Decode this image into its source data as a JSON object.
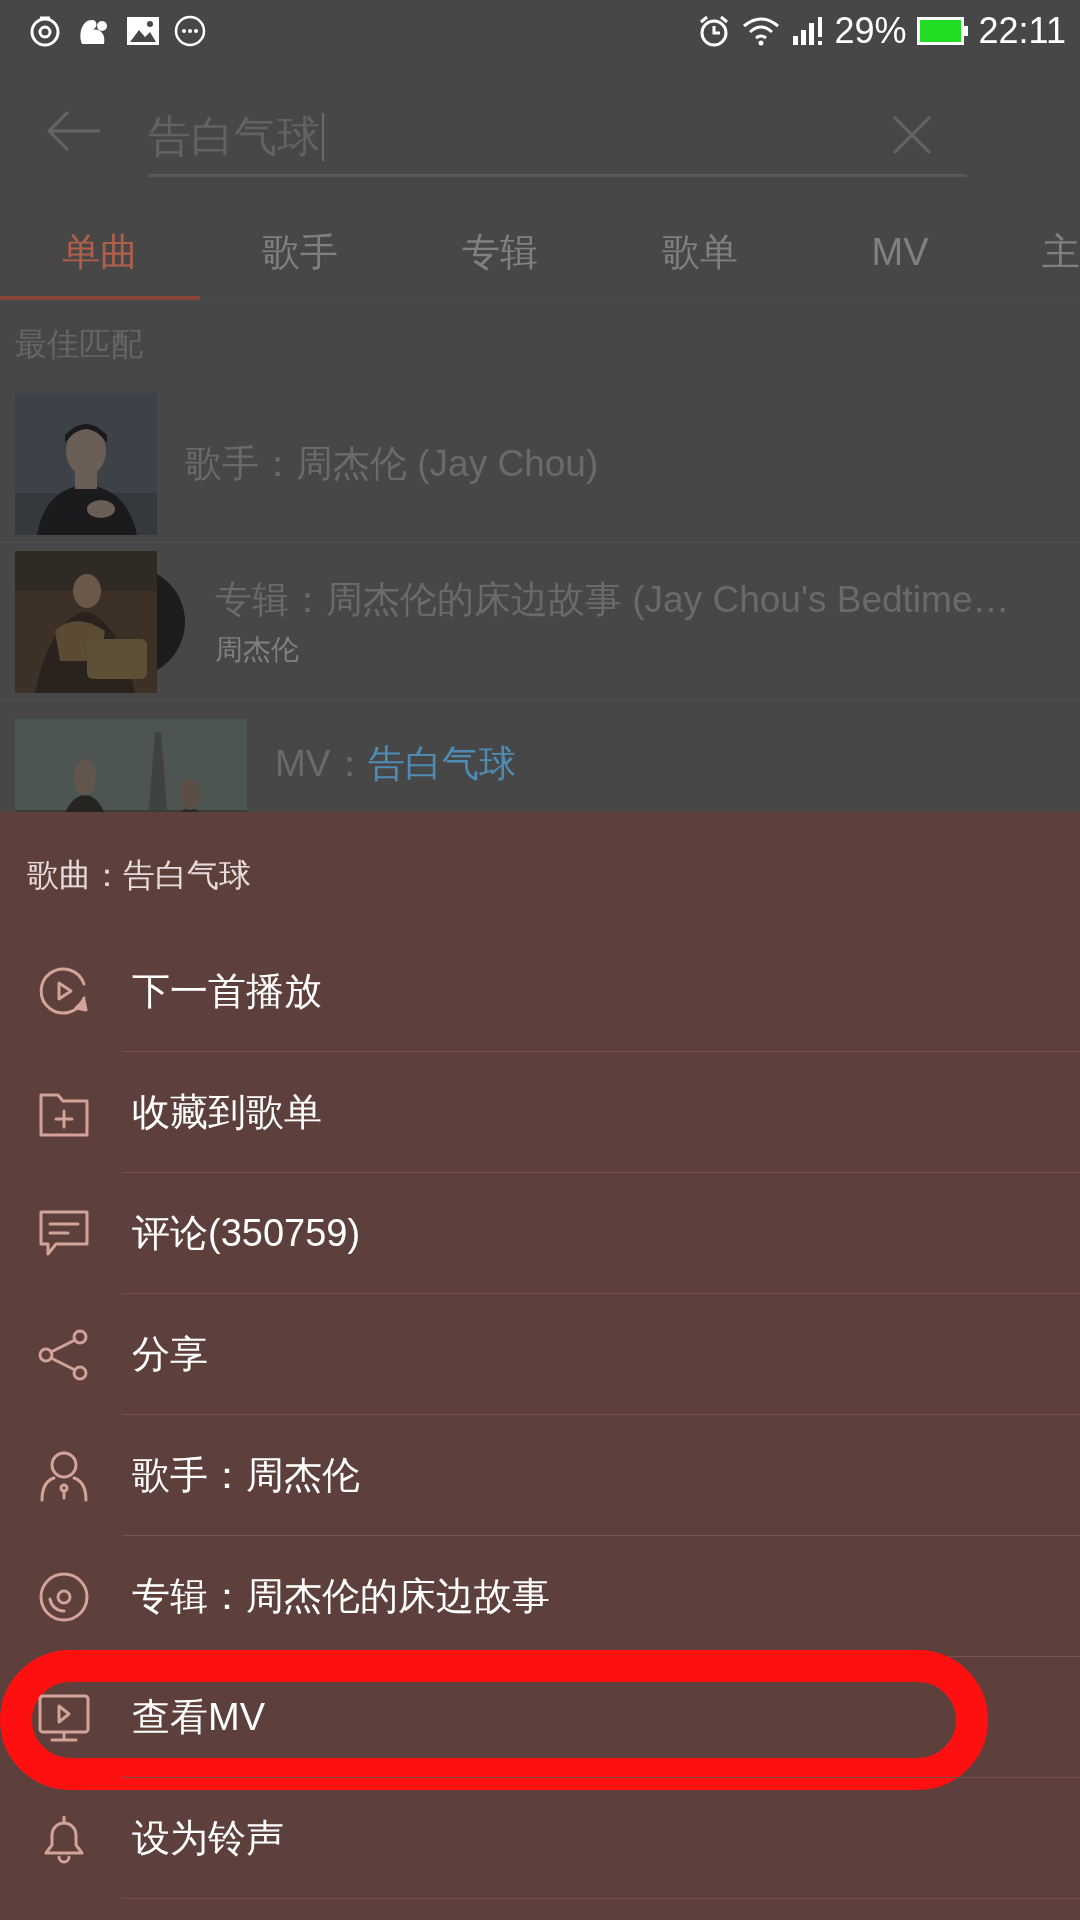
{
  "status_bar": {
    "battery": "29%",
    "time": "22:11"
  },
  "search": {
    "value": "告白气球"
  },
  "tabs": [
    {
      "label": "单曲",
      "selected": true
    },
    {
      "label": "歌手",
      "selected": false
    },
    {
      "label": "专辑",
      "selected": false
    },
    {
      "label": "歌单",
      "selected": false
    },
    {
      "label": "MV",
      "selected": false
    },
    {
      "label": "主",
      "selected": false
    }
  ],
  "best_match": {
    "heading": "最佳匹配",
    "results": [
      {
        "kind": "artist",
        "title": "歌手：周杰伦 (Jay Chou)"
      },
      {
        "kind": "album",
        "title": "专辑：周杰伦的床边故事 (Jay Chou's Bedtime…",
        "subtitle": "周杰伦"
      },
      {
        "kind": "mv",
        "prefix": "MV：",
        "title": "告白气球"
      }
    ]
  },
  "sheet": {
    "title": "歌曲：告白气球",
    "items": [
      {
        "kind": "next",
        "label": "下一首播放",
        "highlighted": false
      },
      {
        "kind": "collect",
        "label": "收藏到歌单",
        "highlighted": false
      },
      {
        "kind": "comment",
        "label": "评论(350759)",
        "highlighted": false
      },
      {
        "kind": "share",
        "label": "分享",
        "highlighted": false
      },
      {
        "kind": "artist",
        "label": "歌手：周杰伦",
        "highlighted": false
      },
      {
        "kind": "album",
        "label": "专辑：周杰伦的床边故事",
        "highlighted": false
      },
      {
        "kind": "mv",
        "label": "查看MV",
        "highlighted": true
      },
      {
        "kind": "ringtone",
        "label": "设为铃声",
        "highlighted": false
      }
    ]
  }
}
